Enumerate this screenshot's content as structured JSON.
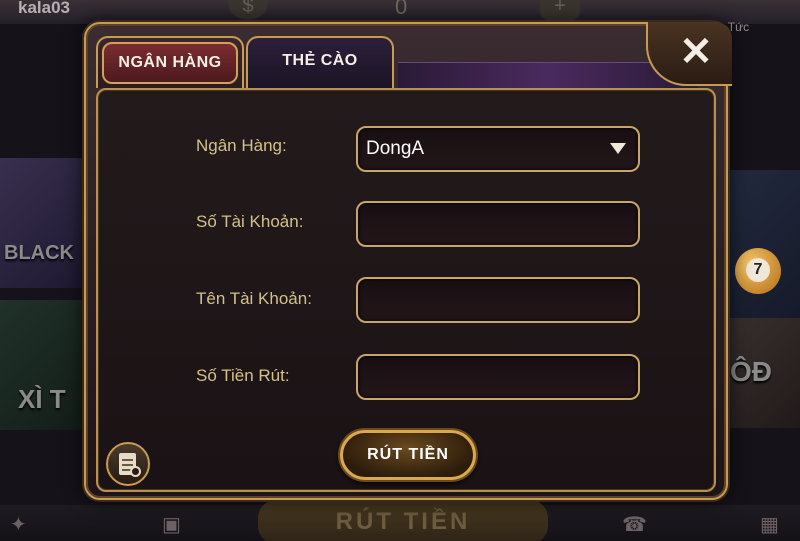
{
  "background": {
    "username": "kala03",
    "balance": "0",
    "news_label": "n Tức",
    "tile_labels": [
      "BLACK",
      "XÌ T",
      "ÔĐ"
    ],
    "ball_number": "7",
    "bottom_button": "RÚT TIỀN"
  },
  "tabs": [
    {
      "label": "NGÂN HÀNG",
      "active": true
    },
    {
      "label": "THẺ CÀO",
      "active": false
    }
  ],
  "close_label": "✕",
  "form": {
    "bank_label": "Ngân Hàng:",
    "bank_value": "DongA",
    "account_number_label": "Số Tài Khoản:",
    "account_number_value": "",
    "account_name_label": "Tên Tài Khoản:",
    "account_name_value": "",
    "amount_label": "Số Tiền Rút:",
    "amount_value": ""
  },
  "submit_label": "RÚT TIỀN",
  "colors": {
    "gold": "#c89b52",
    "label": "#d4c187",
    "active_tab": "#7b2c30"
  },
  "icons": {
    "close": "close-icon",
    "dropdown": "chevron-down-icon",
    "history": "history-icon"
  }
}
